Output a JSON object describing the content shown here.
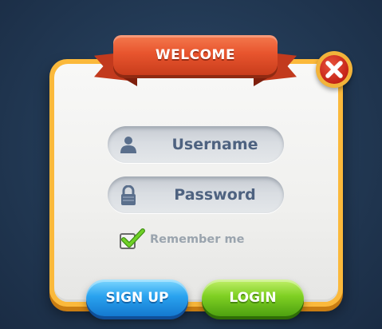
{
  "dialog": {
    "title": "WELCOME",
    "close_icon": "close-x-icon"
  },
  "fields": {
    "username": {
      "label": "Username",
      "icon": "user-icon"
    },
    "password": {
      "label": "Password",
      "icon": "padlock-icon"
    }
  },
  "remember": {
    "label": "Remember me",
    "checked": true
  },
  "buttons": {
    "signup": "SIGN UP",
    "login": "LOGIN"
  },
  "colors": {
    "background": "#223954",
    "panel_frame": "#fbb93b",
    "ribbon": "#e8552e",
    "close_button": "#c42317",
    "field_text": "#4e6280",
    "signup": "#2aa3ef",
    "login": "#7fd023",
    "checkmark": "#5fbf1f"
  }
}
